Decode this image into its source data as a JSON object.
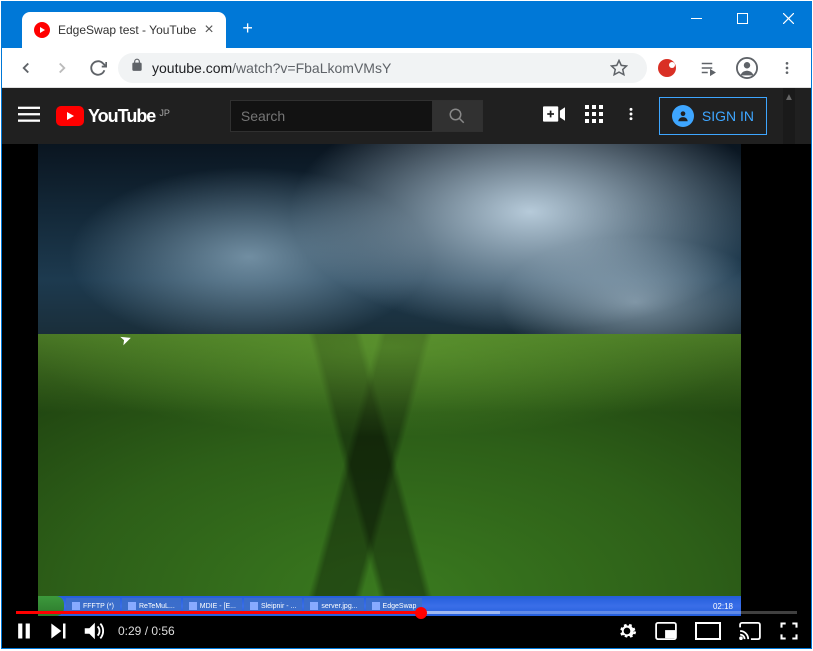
{
  "window": {
    "tab_title": "EdgeSwap test - YouTube"
  },
  "urlbar": {
    "host": "youtube.com",
    "path": "/watch?v=FbaLkomVMsY"
  },
  "yt": {
    "logo_text": "YouTube",
    "logo_region": "JP",
    "search_placeholder": "Search",
    "signin_label": "SIGN IN"
  },
  "player": {
    "time_current": "0:29",
    "time_sep": " / ",
    "time_total": "0:56",
    "progress_percent": 51.8
  },
  "video_taskbar": {
    "items": [
      "FFFTP (*)",
      "ReTeMuL...",
      "MDIE - [E...",
      "Sleipnir - ...",
      "server.jpg...",
      "EdgeSwap"
    ],
    "clock": "02:18"
  }
}
